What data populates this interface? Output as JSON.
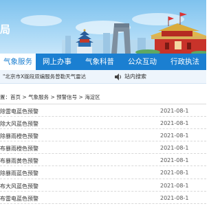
{
  "header": {
    "logo_fragment": "局"
  },
  "nav": {
    "items": [
      {
        "label": "气象服务",
        "active": true
      },
      {
        "label": "网上办事",
        "active": false
      },
      {
        "label": "气象科普",
        "active": false
      },
      {
        "label": "公众互动",
        "active": false
      },
      {
        "label": "行政执法",
        "active": false
      }
    ]
  },
  "ticker": {
    "text": "\"北京市X拨段双编服务曾勒天气雷达"
  },
  "site_search": {
    "label": "站内搜索",
    "icon": "speaker-icon"
  },
  "breadcrumb": {
    "prefix": "置：",
    "items": [
      "首页",
      "气象服务",
      "预警信号",
      "海淀区"
    ],
    "separator": " > "
  },
  "list": {
    "rows": [
      {
        "title": "除雷电蓝色预警",
        "date": "2021-08-1"
      },
      {
        "title": "除大风蓝色预警",
        "date": "2021-08-1"
      },
      {
        "title": "除暴雨橙色预警",
        "date": "2021-08-1"
      },
      {
        "title": "布暴雨橙色预警",
        "date": "2021-08-1"
      },
      {
        "title": "布暴雨黄色预警",
        "date": "2021-08-1"
      },
      {
        "title": "除暴雨蓝色预警",
        "date": "2021-08-1"
      },
      {
        "title": "布大风蓝色预警",
        "date": "2021-08-1"
      },
      {
        "title": "布雷电蓝色预警",
        "date": "2021-08-1"
      }
    ]
  },
  "colors": {
    "nav_bg": "#1b7fd1",
    "accent": "#1b7fd1",
    "sky": "#a5d6f5"
  }
}
